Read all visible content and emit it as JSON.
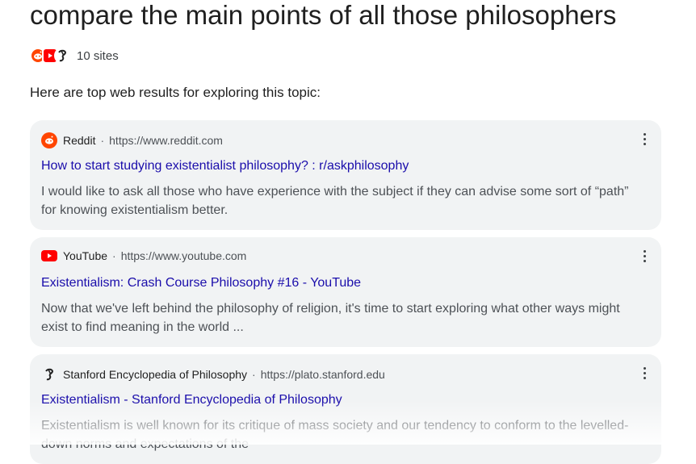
{
  "query": "compare the main points of all those philosophers",
  "sites_label": "10 sites",
  "intro": "Here are top web results for exploring this topic:",
  "colors": {
    "reddit": "#ff4500",
    "youtube": "#ff0000",
    "link": "#1a0dab"
  },
  "results": [
    {
      "icon": "reddit-icon",
      "source": "Reddit",
      "url": "https://www.reddit.com",
      "title": "How to start studying existentialist philosophy? : r/askphilosophy",
      "snippet": "I would like to ask all those who have experience with the subject if they can advise some sort of “path” for knowing existentialism better."
    },
    {
      "icon": "youtube-icon",
      "source": "YouTube",
      "url": "https://www.youtube.com",
      "title": "Existentialism: Crash Course Philosophy #16 - YouTube",
      "snippet": "Now that we've left behind the philosophy of religion, it's time to start exploring what other ways might exist to find meaning in the world ..."
    },
    {
      "icon": "stanford-encyclopedia-icon",
      "source": "Stanford Encyclopedia of Philosophy",
      "url": "https://plato.stanford.edu",
      "title": "Existentialism - Stanford Encyclopedia of Philosophy",
      "snippet": "Existentialism is well known for its critique of mass society and our tendency to conform to the levelled-down norms and expectations of the"
    }
  ]
}
